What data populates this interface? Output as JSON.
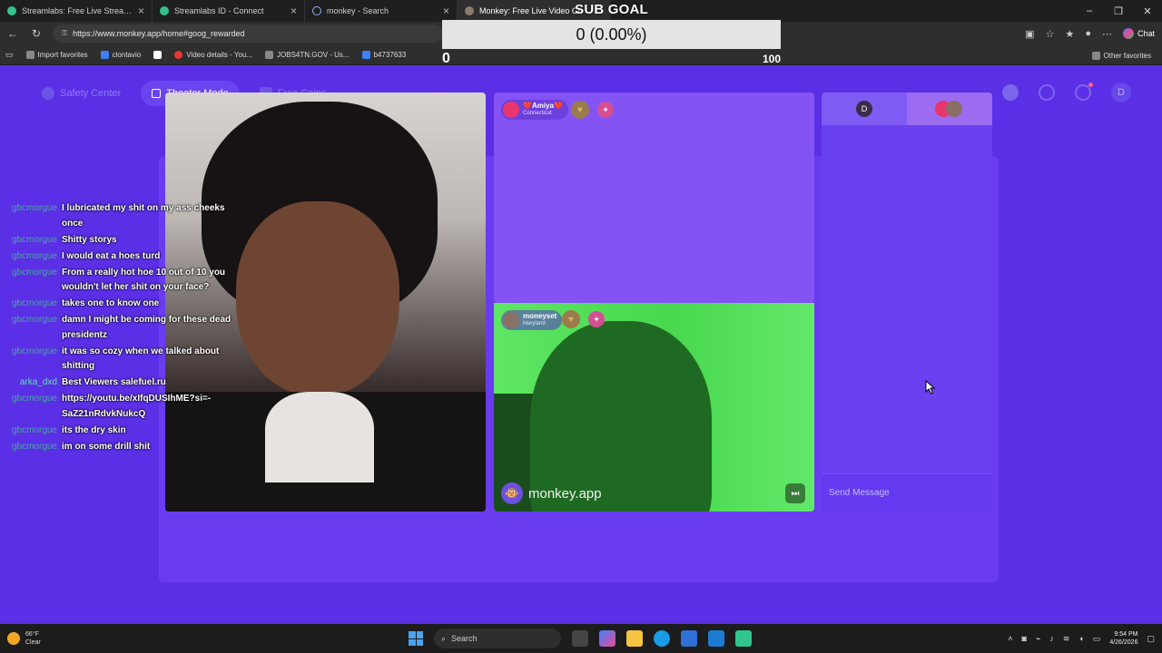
{
  "browser": {
    "tabs": [
      {
        "title": "Streamlabs: Free Live Streaming &",
        "active": false
      },
      {
        "title": "Streamlabs ID - Connect",
        "active": false
      },
      {
        "title": "monkey - Search",
        "active": false
      },
      {
        "title": "Monkey: Free Live Video Ch",
        "active": true
      }
    ],
    "url": "https://www.monkey.app/home#goog_rewarded",
    "chat_label": "Chat",
    "bookmarks": [
      "Import favorites",
      "clontavio",
      "",
      "Video details - You...",
      "JOBS4TN.GOV - Us...",
      "b4737633"
    ],
    "other_favorites": "Other favorites"
  },
  "subgoal": {
    "title": "SUB GOAL",
    "display": "0 (0.00%)",
    "progress": 0,
    "min": "0",
    "max": "100"
  },
  "nav": {
    "safety": "Safety Center",
    "theater": "Theater Mode",
    "coins": "Free Coins",
    "avatar_letter": "D"
  },
  "partner1": {
    "name": "❤️Amiya❤️",
    "location": "Connecticut"
  },
  "partner2": {
    "name": "moneyset",
    "location": "Maryland"
  },
  "watermark": "monkey.app",
  "chat_panel": {
    "self_letter": "D",
    "placeholder": "Send Message"
  },
  "chat_log": [
    {
      "user": "gbcmorgue",
      "msg": "I lubricated my shit on my ass cheeks once"
    },
    {
      "user": "gbcmorgue",
      "msg": "Shitty storys"
    },
    {
      "user": "gbcmorgue",
      "msg": "I would eat a hoes turd"
    },
    {
      "user": "gbcmorgue",
      "msg": "From a really hot hoe 10 out of 10 you wouldn't let her shit on your face?"
    },
    {
      "user": "gbcmorgue",
      "msg": "takes one to know one"
    },
    {
      "user": "gbcmorgue",
      "msg": "damn I might be coming for these dead presidentz"
    },
    {
      "user": "gbcmorgue",
      "msg": "it was so cozy when we talked about shitting"
    },
    {
      "user": "arka_dxd",
      "msg": "Best Viewers salefuel.ru"
    },
    {
      "user": "gbcmorgue",
      "msg": "https://youtu.be/xIfqDUSIhME?si=-SaZ21nRdvkNukcQ"
    },
    {
      "user": "gbcmorgue",
      "msg": "its the dry skin"
    },
    {
      "user": "gbcmorgue",
      "msg": "im on some drill shit"
    }
  ],
  "taskbar": {
    "temp": "66°F",
    "weather": "Clear",
    "search": "Search",
    "time": "9:54 PM",
    "date": "4/26/2026"
  },
  "colors": {
    "accent": "#5a2fe6",
    "goal_bar": "#e4e4e4",
    "username": "#3fae8e"
  }
}
